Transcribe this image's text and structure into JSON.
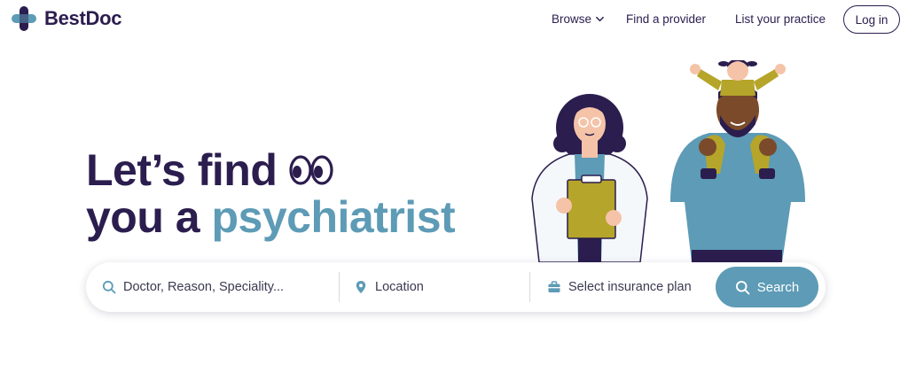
{
  "brand": {
    "name": "BestDoc",
    "color_primary": "#2b1d4e",
    "color_accent": "#5d9bb6"
  },
  "nav": {
    "browse_label": "Browse",
    "find_provider_label": "Find a provider",
    "list_practice_label": "List your practice",
    "login_label": "Log in"
  },
  "hero": {
    "line1": "Let’s find",
    "line2_prefix": "you a ",
    "line2_accent": "psychiatrist"
  },
  "search": {
    "doctor_placeholder": "Doctor, Reason, Speciality...",
    "location_placeholder": "Location",
    "insurance_placeholder": "Select insurance plan",
    "button_label": "Search"
  },
  "icons": {
    "logo": "cross-logo-icon",
    "browse": "chevron-down-icon",
    "eyes": "eyes-icon",
    "doctor_field": "search-icon",
    "location_field": "location-pin-icon",
    "insurance_field": "briefcase-icon",
    "search_button": "search-icon"
  }
}
